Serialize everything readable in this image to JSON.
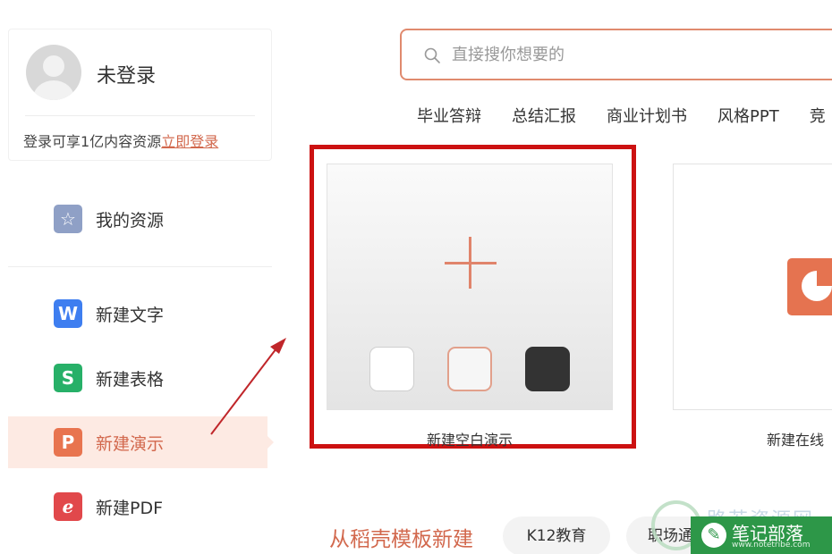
{
  "user": {
    "name": "未登录",
    "tip": "登录可享1亿内容资源",
    "login_link": "立即登录"
  },
  "menu": {
    "items": [
      {
        "label": "我的资源",
        "icon": "star-icon",
        "glyph": "☆",
        "color": "#8fa0c6"
      },
      {
        "label": "新建文字",
        "icon": "wps-writer-icon",
        "glyph": "W",
        "color": "#3e7ef0"
      },
      {
        "label": "新建表格",
        "icon": "wps-sheet-icon",
        "glyph": "S",
        "color": "#27b068"
      },
      {
        "label": "新建演示",
        "icon": "wps-presentation-icon",
        "glyph": "P",
        "color": "#e8744f"
      },
      {
        "label": "新建PDF",
        "icon": "pdf-icon",
        "glyph": "ℯ",
        "color": "#e1484b"
      }
    ],
    "active": "新建演示"
  },
  "search": {
    "placeholder": "直接搜你想要的",
    "value": ""
  },
  "tags": [
    "毕业答辩",
    "总结汇报",
    "商业计划书",
    "风格PPT",
    "竞"
  ],
  "cards": {
    "blank": {
      "caption": "新建空白演示",
      "swatch_colors": [
        "#ffffff",
        "#f6f6f6",
        "#333333"
      ]
    },
    "online": {
      "caption": "新建在线"
    }
  },
  "templates": {
    "title": "从稻壳模板新建",
    "pills": [
      "K12教育",
      "职场通"
    ]
  },
  "watermark": {
    "faint_text": "路若资源网",
    "badge_text": "笔记部落",
    "url": "www.notetribe.com"
  },
  "colors": {
    "accent": "#d2684d",
    "highlight_frame": "#cc1111",
    "active_bg": "#fdeae3"
  }
}
